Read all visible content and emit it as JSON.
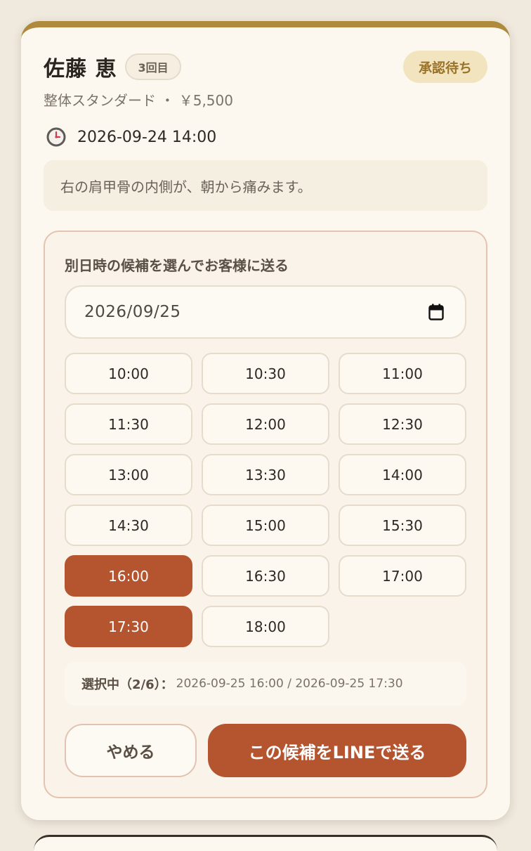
{
  "reservation": {
    "customer_name": "佐藤 恵",
    "visit_badge": "3回目",
    "status": "承認待ち",
    "service_line": "整体スタンダード ・ ￥5,500",
    "datetime_icon": "clock-icon",
    "datetime": "2026-09-24 14:00",
    "note": "右の肩甲骨の内側が、朝から痛みます。"
  },
  "proposal": {
    "title": "別日時の候補を選んでお客様に送る",
    "date_value": "2026/09/25",
    "calendar_icon": "calendar-icon",
    "slots": [
      {
        "time": "10:00",
        "selected": false
      },
      {
        "time": "10:30",
        "selected": false
      },
      {
        "time": "11:00",
        "selected": false
      },
      {
        "time": "11:30",
        "selected": false
      },
      {
        "time": "12:00",
        "selected": false
      },
      {
        "time": "12:30",
        "selected": false
      },
      {
        "time": "13:00",
        "selected": false
      },
      {
        "time": "13:30",
        "selected": false
      },
      {
        "time": "14:00",
        "selected": false
      },
      {
        "time": "14:30",
        "selected": false
      },
      {
        "time": "15:00",
        "selected": false
      },
      {
        "time": "15:30",
        "selected": false
      },
      {
        "time": "16:00",
        "selected": true
      },
      {
        "time": "16:30",
        "selected": false
      },
      {
        "time": "17:00",
        "selected": false
      },
      {
        "time": "17:30",
        "selected": true
      },
      {
        "time": "18:00",
        "selected": false
      }
    ],
    "summary_label": "選択中（2/6）：",
    "summary_values": "2026-09-25 16:00 / 2026-09-25 17:30",
    "cancel_label": "やめる",
    "send_label": "この候補をLINEで送る"
  },
  "colors": {
    "accent_top": "#b08a3c",
    "selected_slot": "#b5552f",
    "status_badge_bg": "#f3e4c0",
    "status_badge_text": "#9a7328"
  }
}
